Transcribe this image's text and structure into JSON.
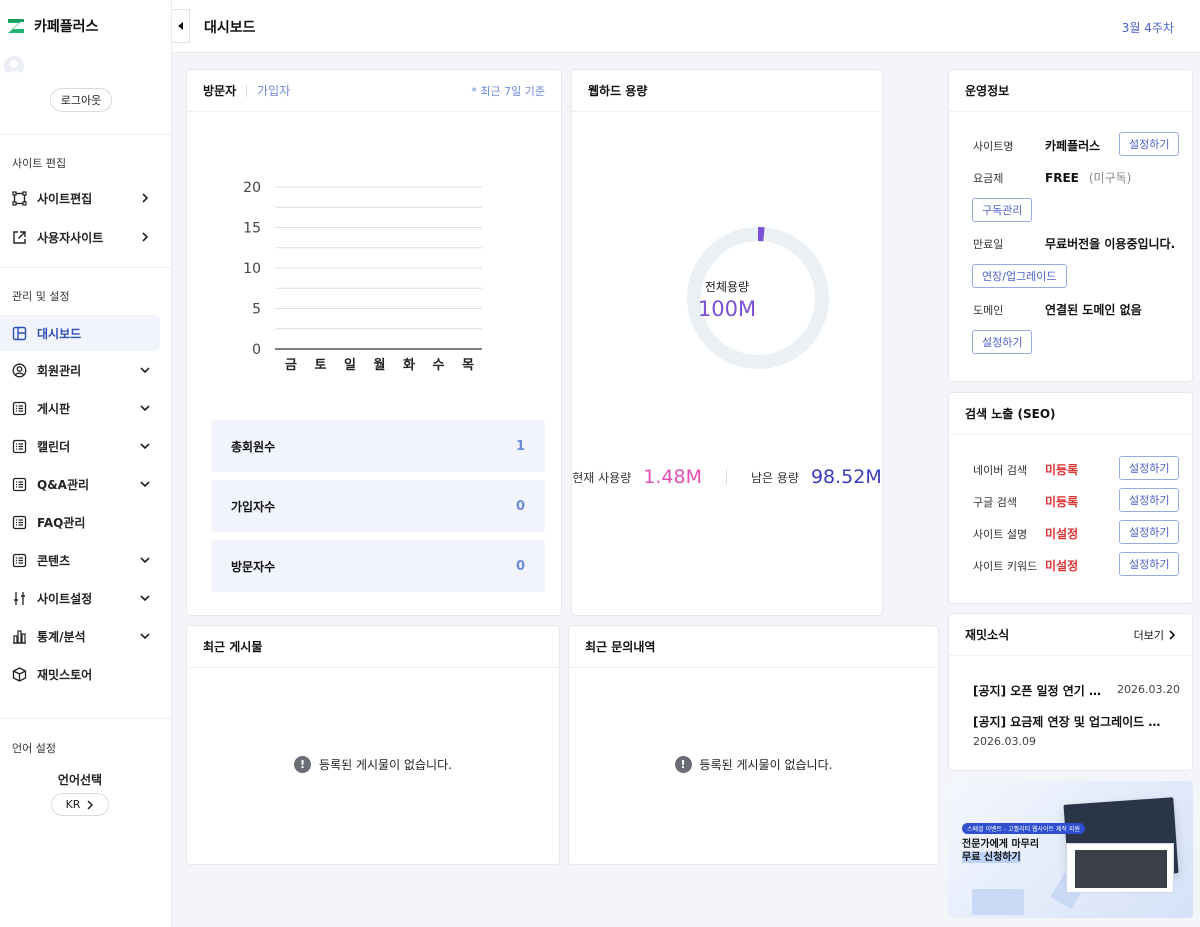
{
  "brand": {
    "name": "카페플러스",
    "logo_color": "#22b573"
  },
  "sidebar": {
    "logout_label": "로그아웃",
    "section_edit": "사이트 편집",
    "edit_items": [
      {
        "label": "사이트편집",
        "icon": "frame-icon"
      },
      {
        "label": "사용자사이트",
        "icon": "external-link-icon"
      }
    ],
    "section_manage": "관리 및 설정",
    "manage_items": [
      {
        "label": "대시보드",
        "icon": "layout-icon",
        "active": true
      },
      {
        "label": "회원관리",
        "icon": "user-circle-icon"
      },
      {
        "label": "게시판",
        "icon": "list-icon"
      },
      {
        "label": "캘린더",
        "icon": "list-icon"
      },
      {
        "label": "Q&A관리",
        "icon": "list-icon"
      },
      {
        "label": "FAQ관리",
        "icon": "list-icon"
      },
      {
        "label": "콘텐츠",
        "icon": "list-icon"
      },
      {
        "label": "사이트설정",
        "icon": "sliders-icon"
      },
      {
        "label": "통계/분석",
        "icon": "bar-chart-icon"
      },
      {
        "label": "재밋스토어",
        "icon": "box-icon"
      }
    ],
    "section_language": "언어 설정",
    "language_select_label": "언어선택",
    "language_value": "KR"
  },
  "header": {
    "title": "대시보드",
    "week": "3월 4주차"
  },
  "visitors": {
    "tab_visitors": "방문자",
    "tab_signups": "가입자",
    "note": "* 최근 7일 기준",
    "stats": [
      {
        "label": "총회원수",
        "value": "1"
      },
      {
        "label": "가입자수",
        "value": "0"
      },
      {
        "label": "방문자수",
        "value": "0"
      }
    ]
  },
  "chart_data": {
    "type": "bar",
    "categories": [
      "금",
      "토",
      "일",
      "월",
      "화",
      "수",
      "목"
    ],
    "values": [
      0,
      0,
      0,
      0,
      0,
      0,
      0
    ],
    "title": "",
    "xlabel": "",
    "ylabel": "",
    "ylim": [
      0,
      20
    ],
    "yticks": [
      0,
      5,
      10,
      15,
      20
    ],
    "grid": true
  },
  "storage": {
    "title": "웹하드 용량",
    "total_label": "전체용량",
    "total_value": "100M",
    "used_label": "현재 사용량",
    "used_value": "1.48M",
    "left_label": "남은 용량",
    "left_value": "98.52M",
    "used_fraction": 0.0148,
    "ring_color": "#eaf0f4",
    "used_color": "#7b4fd6",
    "total_text_color": "#7b4fd6"
  },
  "operation": {
    "title": "운영정보",
    "site_name_label": "사이트명",
    "site_name_value": "카페플러스",
    "site_name_btn": "설정하기",
    "plan_label": "요금제",
    "plan_value": "FREE",
    "plan_sub": "(미구독)",
    "plan_btn": "구독관리",
    "expire_label": "만료일",
    "expire_value": "무료버전을 이용중입니다.",
    "expire_btn": "연장/업그레이드",
    "domain_label": "도메인",
    "domain_value": "연결된 도메인 없음",
    "domain_btn": "설정하기"
  },
  "seo": {
    "title": "검색 노출 (SEO)",
    "rows": [
      {
        "label": "네이버 검색",
        "status": "미등록",
        "btn": "설정하기"
      },
      {
        "label": "구글 검색",
        "status": "미등록",
        "btn": "설정하기"
      },
      {
        "label": "사이트 설명",
        "status": "미설정",
        "btn": "설정하기"
      },
      {
        "label": "사이트 키워드",
        "status": "미설정",
        "btn": "설정하기"
      }
    ]
  },
  "news": {
    "title": "재밋소식",
    "more": "더보기",
    "items": [
      {
        "title": "[공지] 오픈 일정 연기 안내",
        "date": "2026.03.20"
      },
      {
        "title": "[공지] 요금제 연장 및 업그레이드 업데...",
        "date": "2026.03.09"
      }
    ]
  },
  "recent_posts": {
    "title": "최근 게시물",
    "empty": "등록된 게시물이 없습니다."
  },
  "recent_inquiries": {
    "title": "최근 문의내역",
    "empty": "등록된 게시물이 없습니다."
  },
  "banner": {
    "tag": "스페셜 이벤트 - 고퀄리티 웹사이트 제작 지원",
    "line1": "전문가에게 마무리",
    "line2": "무료 신청하기"
  }
}
